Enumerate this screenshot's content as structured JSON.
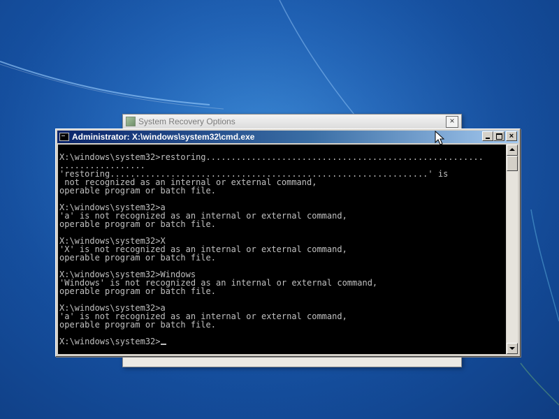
{
  "background_window": {
    "title": "System Recovery Options",
    "close_label": "×"
  },
  "cmd_window": {
    "title": "Administrator: X:\\windows\\system32\\cmd.exe",
    "close_label": "×",
    "console_lines": [
      "",
      "X:\\windows\\system32>restoring.......................................................",
      ".................",
      "'restoring...............................................................' is",
      " not recognized as an internal or external command,",
      "operable program or batch file.",
      "",
      "X:\\windows\\system32>a",
      "'a' is not recognized as an internal or external command,",
      "operable program or batch file.",
      "",
      "X:\\windows\\system32>X",
      "'X' is not recognized as an internal or external command,",
      "operable program or batch file.",
      "",
      "X:\\windows\\system32>Windows",
      "'Windows' is not recognized as an internal or external command,",
      "operable program or batch file.",
      "",
      "X:\\windows\\system32>a",
      "'a' is not recognized as an internal or external command,",
      "operable program or batch file.",
      ""
    ],
    "prompt": "X:\\windows\\system32>"
  },
  "colors": {
    "console_bg": "#000000",
    "console_fg": "#c0c0c0",
    "titlebar_active": "#0a246a",
    "desktop": "#1f63b8"
  },
  "icons": {
    "cmd": "cmd-icon",
    "recovery": "recovery-icon",
    "mouse": "mouse-pointer-icon"
  }
}
